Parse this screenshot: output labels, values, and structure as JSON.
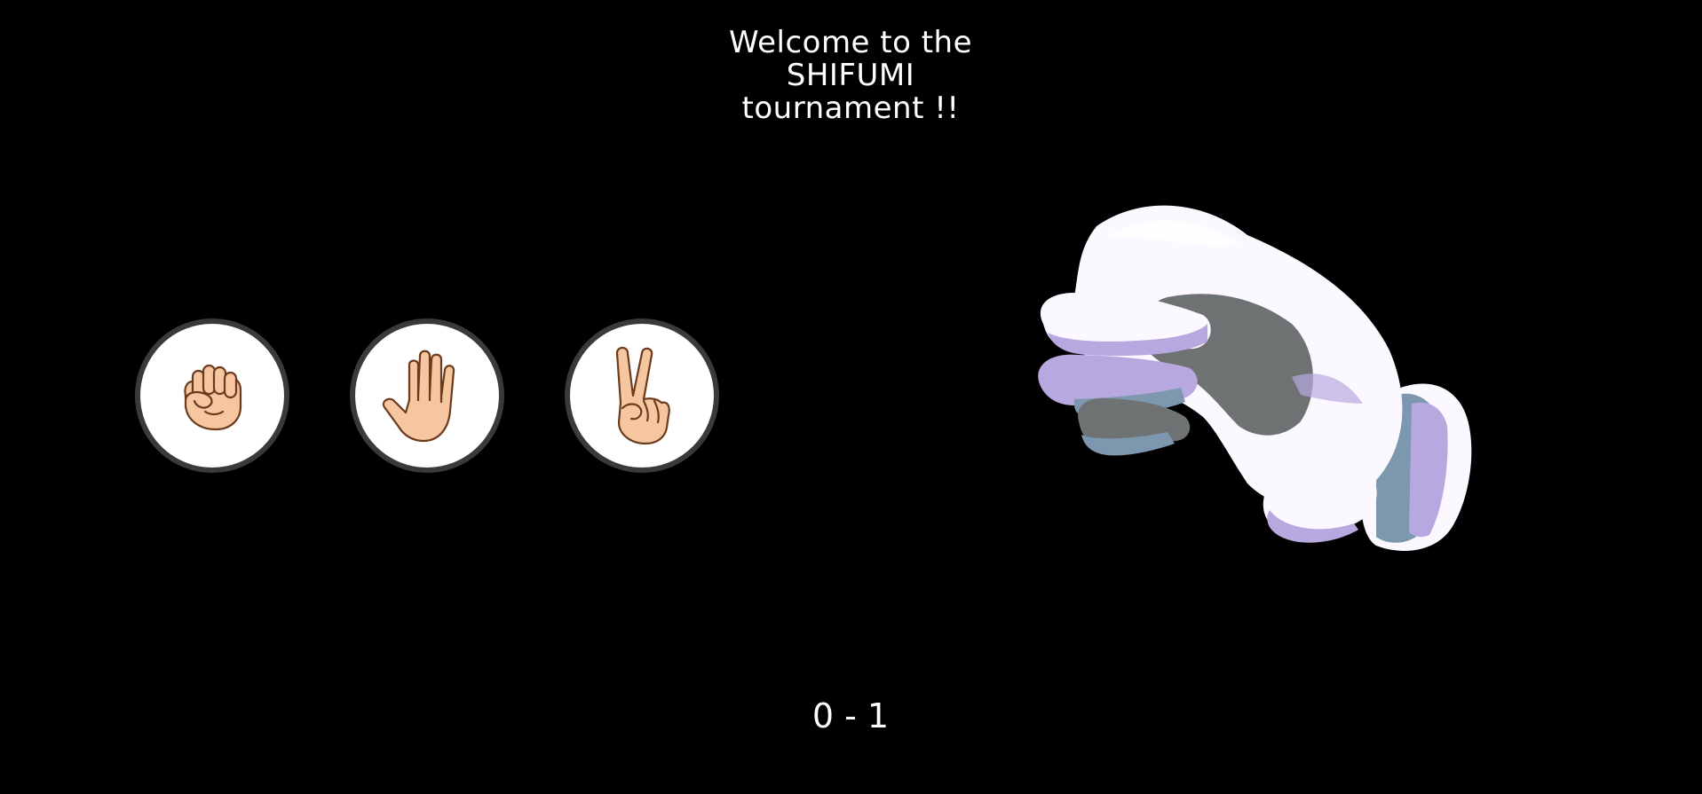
{
  "title": {
    "line1": "Welcome to the",
    "line2": "SHIFUMI",
    "line3": "tournament !!"
  },
  "choices": [
    {
      "name": "rock",
      "icon": "rock-hand-icon"
    },
    {
      "name": "paper",
      "icon": "paper-hand-icon"
    },
    {
      "name": "scissors",
      "icon": "scissors-hand-icon"
    }
  ],
  "opponent": {
    "icon": "opponent-glove-hand-icon"
  },
  "score": "0 - 1",
  "colors": {
    "background": "#000000",
    "text": "#ffffff",
    "button_fill": "#ffffff",
    "button_border": "#3a3a3a",
    "skin": "#f5c6a0",
    "skin_outline": "#6b3b1d",
    "glove_white": "#fbf8ff",
    "glove_lavender": "#b7a9e0",
    "glove_blue": "#7d97ae",
    "glove_dark": "#6e7272"
  }
}
